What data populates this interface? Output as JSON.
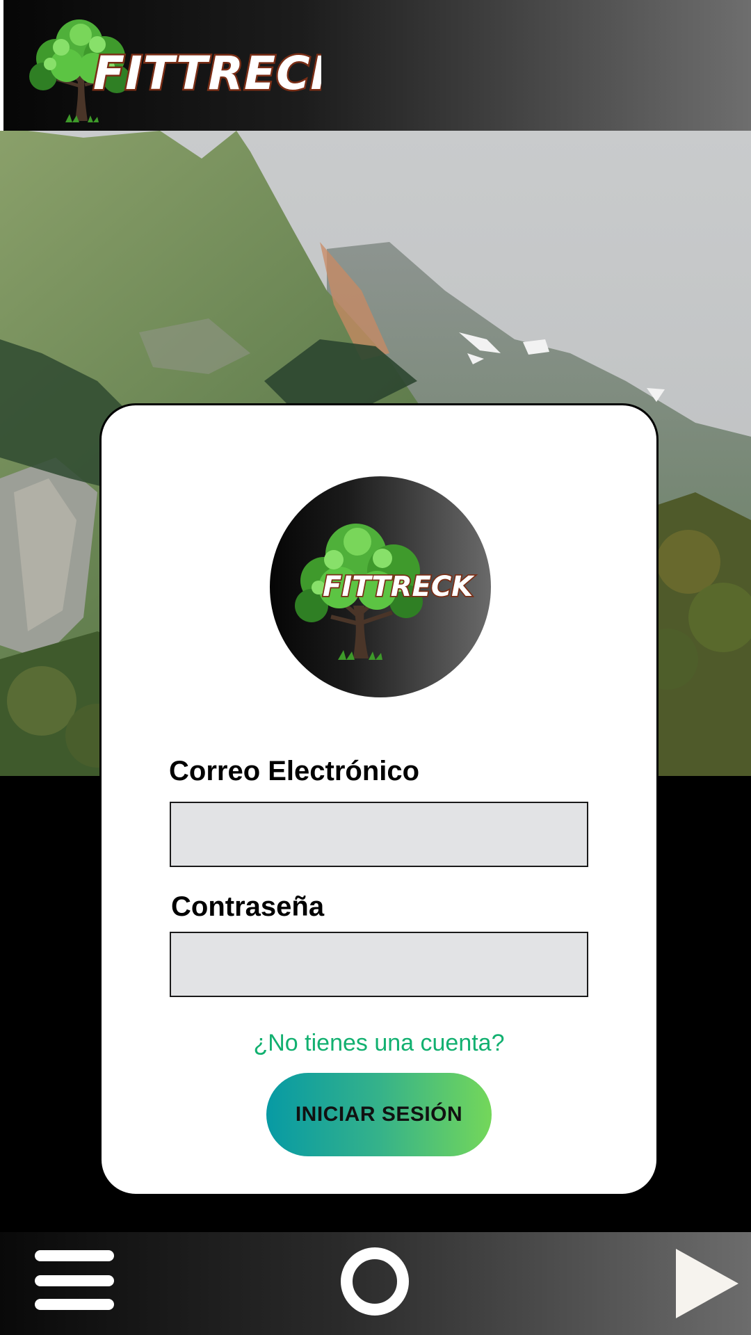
{
  "app": {
    "brand": "FITTRECK"
  },
  "login": {
    "email_label": "Correo Electrónico",
    "email_value": "",
    "password_label": "Contraseña",
    "password_value": "",
    "signup_link": "¿No tienes una cuenta?",
    "submit_label": "INICIAR SESIÓN"
  },
  "navbar": {
    "menu_icon": "hamburger-menu-icon",
    "home_icon": "circle-home-icon",
    "next_icon": "play-triangle-icon"
  },
  "colors": {
    "link": "#12b070",
    "button_gradient_start": "#079aa4",
    "button_gradient_end": "#74d75a",
    "field_background": "#e2e3e5"
  }
}
